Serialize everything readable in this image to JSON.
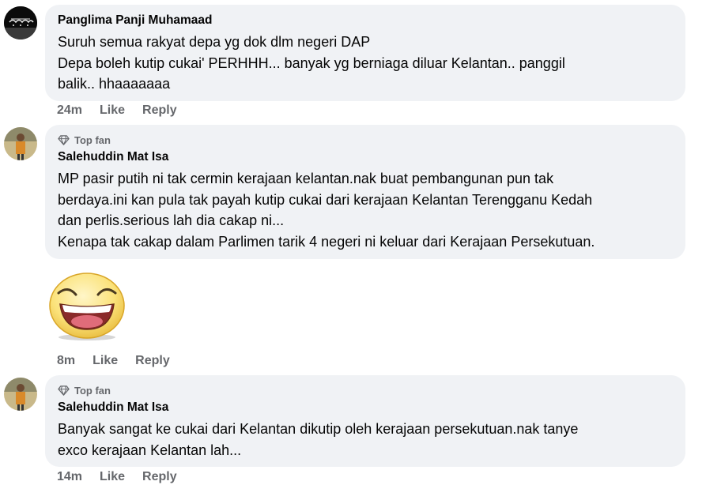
{
  "comments": [
    {
      "author": "Panglima Panji Muhamaad",
      "badge": "",
      "lines": [
        "Suruh semua rakyat depa yg dok dlm negeri DAP",
        "Depa boleh kutip cukai' PERHHH... banyak yg berniaga diluar Kelantan.. panggil",
        "balik.. hhaaaaaaa"
      ],
      "time": "24m",
      "like": "Like",
      "reply": "Reply"
    },
    {
      "author": "Salehuddin Mat Isa",
      "badge": "Top fan",
      "lines": [
        "MP pasir putih ni tak cermin kerajaan kelantan.nak buat pembangunan pun tak",
        "berdaya.ini kan pula tak payah kutip cukai dari kerajaan Kelantan Terengganu Kedah",
        "dan perlis.serious lah dia cakap ni...",
        "Kenapa tak cakap dalam Parlimen tarik 4 negeri ni keluar dari Kerajaan Persekutuan."
      ]
    },
    {
      "sticker": "laughing-face",
      "time": "8m",
      "like": "Like",
      "reply": "Reply"
    },
    {
      "author": "Salehuddin Mat Isa",
      "badge": "Top fan",
      "lines": [
        "Banyak sangat ke cukai dari Kelantan dikutip oleh kerajaan persekutuan.nak tanye",
        "exco kerajaan Kelantan lah..."
      ],
      "time": "14m",
      "like": "Like",
      "reply": "Reply"
    }
  ],
  "colors": {
    "bubble": "#f0f2f5",
    "meta": "#65676b",
    "text": "#050505"
  }
}
